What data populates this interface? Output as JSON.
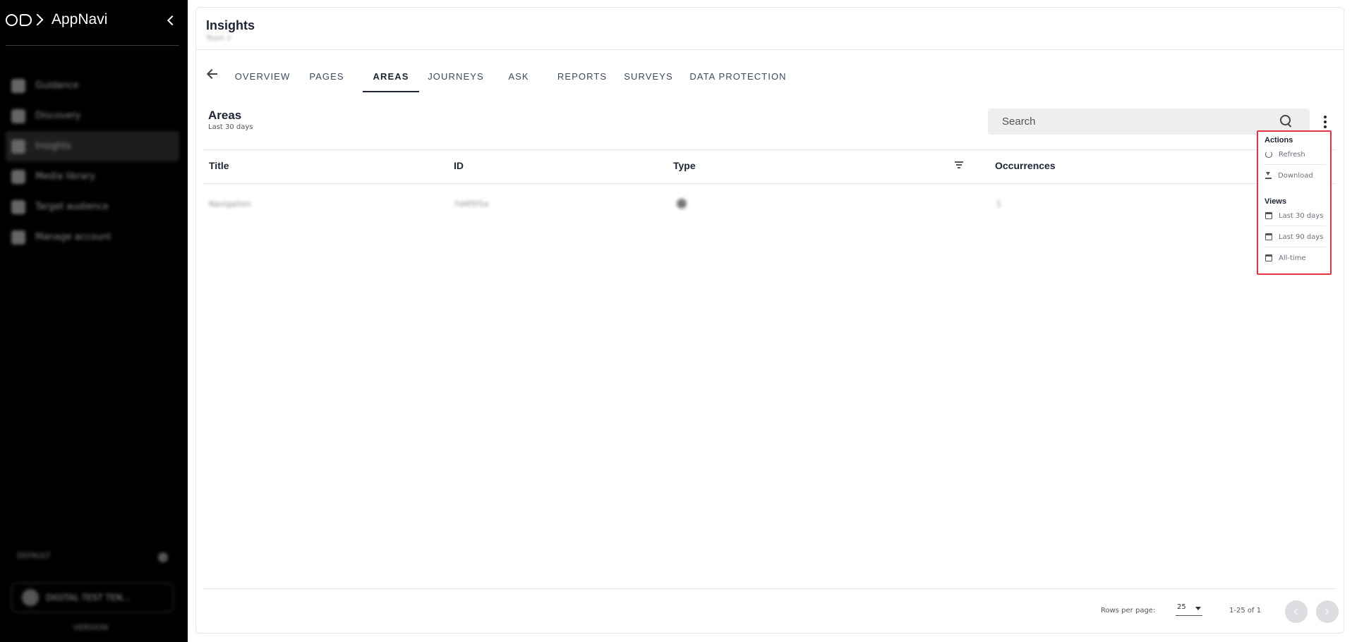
{
  "app": {
    "name": "AppNavi"
  },
  "sidebar": {
    "items": [
      {
        "label": "Guidance"
      },
      {
        "label": "Discovery"
      },
      {
        "label": "Insights",
        "active": true
      },
      {
        "label": "Media library"
      },
      {
        "label": "Target audience"
      },
      {
        "label": "Manage account"
      }
    ],
    "footer_label": "DEFAULT",
    "account_label": "DIGITAL TEST TEN...",
    "account_sub": "VERSION"
  },
  "header": {
    "title": "Insights",
    "subtitle": "Team 1"
  },
  "tabs": [
    {
      "label": "OVERVIEW"
    },
    {
      "label": "PAGES"
    },
    {
      "label": "AREAS",
      "active": true
    },
    {
      "label": "JOURNEYS"
    },
    {
      "label": "ASK"
    },
    {
      "label": "REPORTS"
    },
    {
      "label": "SURVEYS"
    },
    {
      "label": "DATA PROTECTION"
    }
  ],
  "section": {
    "title": "Areas",
    "subtitle": "Last 30 days"
  },
  "search": {
    "placeholder": "Search",
    "value": ""
  },
  "table": {
    "columns": [
      "Title",
      "ID",
      "Type",
      "Occurrences"
    ],
    "rows": [
      {
        "title": "Navigation",
        "id": "7d4f5f1e",
        "type": "icon",
        "occurrences": "1"
      }
    ]
  },
  "pagination": {
    "rows_label": "Rows per page:",
    "rows_value": "25",
    "range": "1-25 of 1"
  },
  "menu": {
    "actions_heading": "Actions",
    "refresh": "Refresh",
    "download": "Download",
    "views_heading": "Views",
    "last30": "Last 30 days",
    "last90": "Last 90 days",
    "alltime": "All-time"
  },
  "colors": {
    "sidebar_bg": "#000000",
    "accent_border": "#e53245",
    "text_primary": "#1d2433"
  }
}
